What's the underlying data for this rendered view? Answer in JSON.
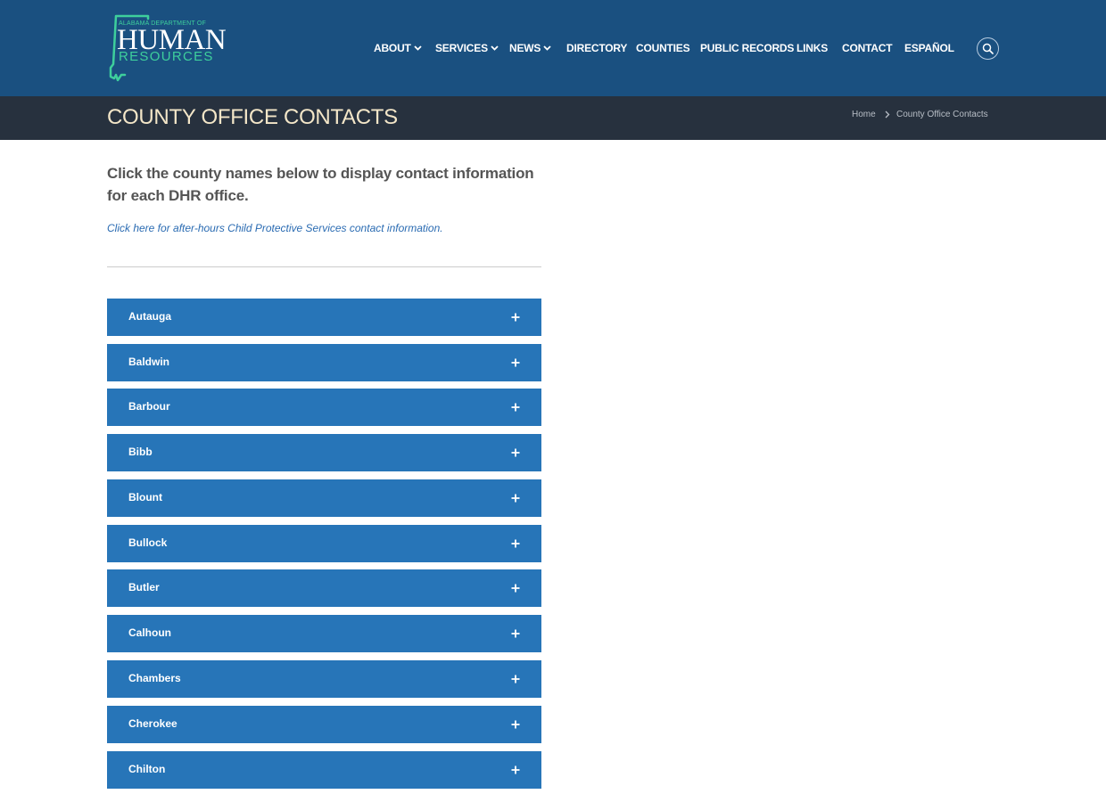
{
  "logo": {
    "small_text": "ALABAMA DEPARTMENT OF",
    "main_text": "HUMAN",
    "sub_text": "RESOURCES",
    "accent_color": "#3ecf9c"
  },
  "nav": {
    "items": [
      {
        "label": "ABOUT",
        "dropdown": true
      },
      {
        "label": "SERVICES",
        "dropdown": true
      },
      {
        "label": "NEWS",
        "dropdown": true
      },
      {
        "label": "DIRECTORY",
        "dropdown": false
      },
      {
        "label": "COUNTIES",
        "dropdown": false
      },
      {
        "label": "PUBLIC RECORDS",
        "dropdown": false
      },
      {
        "label": "LINKS",
        "dropdown": false
      },
      {
        "label": "CONTACT",
        "dropdown": false
      },
      {
        "label": "ESPAÑOL",
        "dropdown": false
      }
    ],
    "search_icon": "search-icon"
  },
  "page": {
    "title": "COUNTY OFFICE CONTACTS",
    "breadcrumb": {
      "home": "Home",
      "current": "County Office Contacts"
    }
  },
  "content": {
    "intro": "Click the county names below to display contact information for each DHR office.",
    "cps_link": "Click here for after-hours Child Protective Services contact information."
  },
  "counties": [
    "Autauga",
    "Baldwin",
    "Barbour",
    "Bibb",
    "Blount",
    "Bullock",
    "Butler",
    "Calhoun",
    "Chambers",
    "Cherokee",
    "Chilton"
  ],
  "colors": {
    "header_bg": "#1a5080",
    "title_bar_bg": "#27313e",
    "title_text": "#f3e6c8",
    "accordion_bg": "#2775b8",
    "link": "#2a6bb2"
  }
}
